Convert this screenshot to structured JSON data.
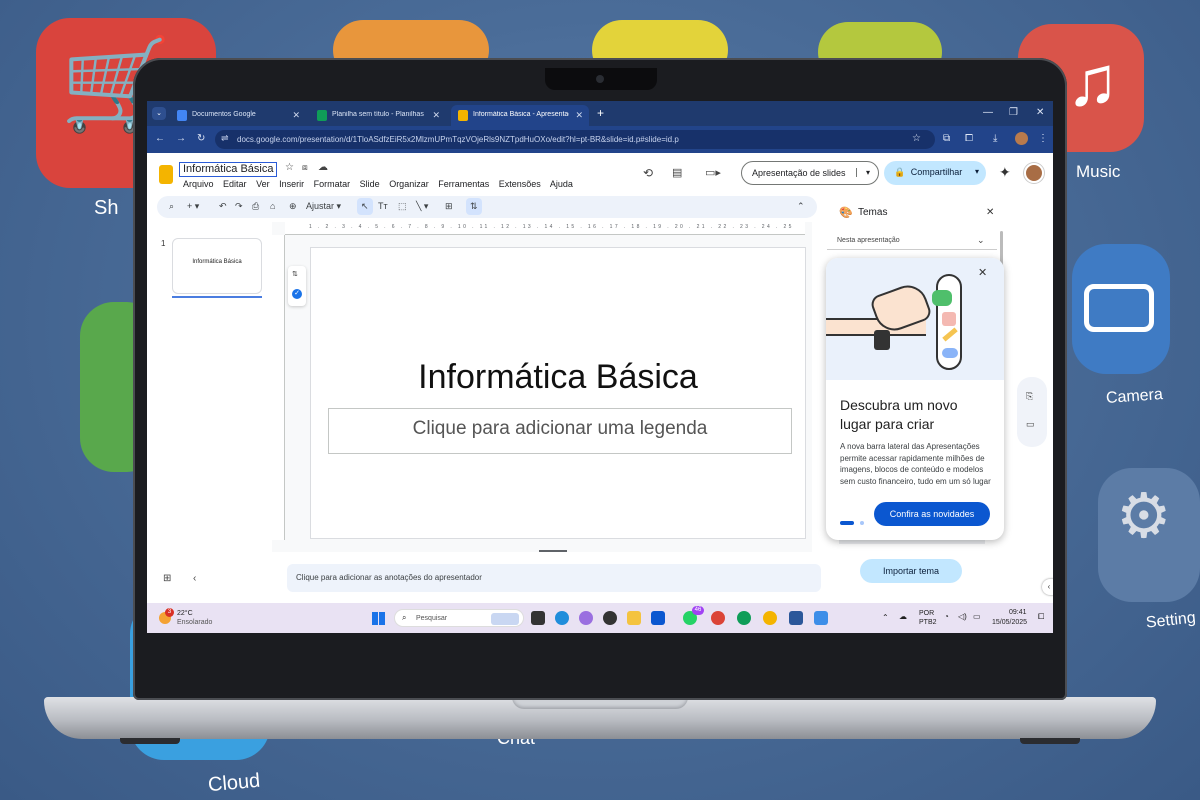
{
  "background": {
    "labels": {
      "shop": "Sh",
      "music": "Music",
      "camera": "Camera",
      "settings": "Setting",
      "cloud": "Cloud",
      "chat": "Chat"
    }
  },
  "browser": {
    "tabs": [
      {
        "label": "Documentos Google",
        "color": "#4285f4"
      },
      {
        "label": "Planilha sem título - Planilhas G",
        "color": "#0f9d58"
      },
      {
        "label": "Informática Básica - Apresentaç",
        "color": "#f4b400"
      }
    ],
    "url": "docs.google.com/presentation/d/1TloASdfzEiR5x2MlzmUPmTqzVOjeRls9NZTpdHuOXo/edit?hl=pt-BR&slide=id.p#slide=id.p"
  },
  "slides_app": {
    "doc_title": "Informática Básica",
    "menu": [
      "Arquivo",
      "Editar",
      "Ver",
      "Inserir",
      "Formatar",
      "Slide",
      "Organizar",
      "Ferramentas",
      "Extensões",
      "Ajuda"
    ],
    "slideshow_label": "Apresentação de slides",
    "share_label": "Compartilhar",
    "toolbar": {
      "zoom_label": "Ajustar"
    },
    "ruler_numbers": "1 . 2 . 3 . 4 . 5 . 6 . 7 . 8 . 9 . 10 . 11 . 12 . 13 . 14 . 15 . 16 . 17 . 18 . 19 . 20 . 21 . 22 . 23 . 24 . 25",
    "thumb": {
      "number": "1",
      "text": "Informática Básica"
    },
    "slide": {
      "title": "Informática Básica",
      "subtitle": "Clique para adicionar uma legenda"
    },
    "notes": "Clique para adicionar as anotações do apresentador",
    "themes_panel": {
      "title": "Temas",
      "dropdown": "Nesta apresentação",
      "import_label": "Importar tema"
    },
    "popup": {
      "title": "Descubra um novo lugar para criar",
      "body": "A nova barra lateral das Apresentações permite acessar rapidamente milhões de imagens, blocos de conteúdo e modelos sem custo financeiro, tudo em um só lugar",
      "button": "Confira as novidades"
    }
  },
  "taskbar": {
    "weather_temp": "22°C",
    "weather_desc": "Ensolarado",
    "weather_badge": "3",
    "search_placeholder": "Pesquisar",
    "lang": "POR",
    "layout": "PTB2",
    "time": "09:41",
    "date": "15/05/2025",
    "whatsapp_badge": "46"
  }
}
